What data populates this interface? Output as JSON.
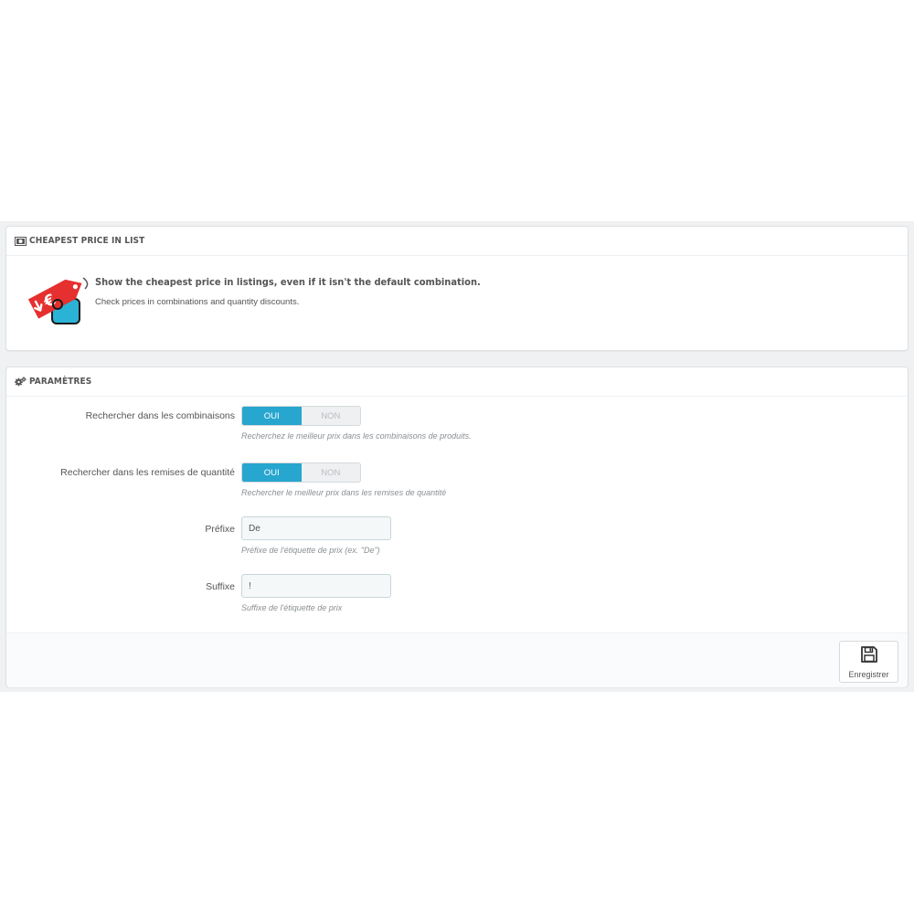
{
  "info_panel": {
    "heading": "CHEAPEST PRICE IN LIST",
    "heading_icon": "money-icon",
    "logo": "price-tag-euro-logo",
    "title": "Show the cheapest price in listings, even if it isn't the default combination.",
    "description": "Check prices in combinations and quantity discounts."
  },
  "settings_panel": {
    "heading": "PARAMÈTRES",
    "heading_icon": "cogs-icon",
    "fields": {
      "combinations": {
        "label": "Rechercher dans les combinaisons",
        "on_label": "OUI",
        "off_label": "NON",
        "selected": "OUI",
        "help": "Recherchez le meilleur prix dans les combinaisons de produits."
      },
      "quantity_discounts": {
        "label": "Rechercher dans les remises de quantité",
        "on_label": "OUI",
        "off_label": "NON",
        "selected": "OUI",
        "help": "Rechercher le meilleur prix dans les remises de quantité"
      },
      "prefix": {
        "label": "Préfixe",
        "value": "De",
        "help": "Préfixe de l'étiquette de prix (ex. \"De\")"
      },
      "suffix": {
        "label": "Suffixe",
        "value": "!",
        "help": "Suffixe de l'étiquette de prix"
      }
    },
    "save_button": {
      "label": "Enregistrer",
      "icon": "floppy-disk-icon"
    }
  },
  "colors": {
    "toggle_active": "#27a6cf",
    "tag_red": "#e5302f",
    "tag_cyan": "#2bb3d6"
  }
}
